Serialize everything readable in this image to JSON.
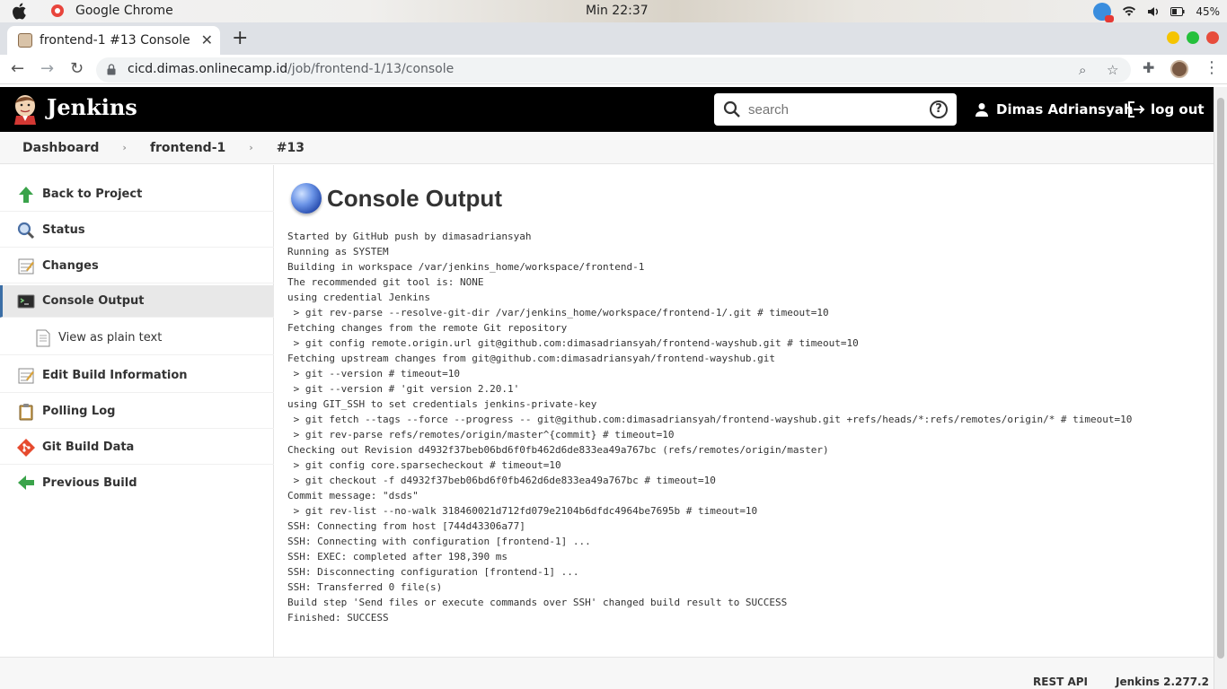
{
  "os": {
    "app_name": "Google Chrome",
    "clock": "Min 22:37",
    "battery": "45%"
  },
  "browser": {
    "tab_title": "frontend-1 #13 Console [",
    "url_domain": "cicd.dimas.onlinecamp.id",
    "url_path": "/job/frontend-1/13/console"
  },
  "header": {
    "brand": "Jenkins",
    "search_placeholder": "search",
    "user_name": "Dimas Adriansyah",
    "logout_label": "log out"
  },
  "breadcrumb": [
    "Dashboard",
    "frontend-1",
    "#13"
  ],
  "sidebar": {
    "items": [
      {
        "label": "Back to Project",
        "icon": "up-arrow-icon"
      },
      {
        "label": "Status",
        "icon": "magnifier-icon"
      },
      {
        "label": "Changes",
        "icon": "notepad-icon"
      },
      {
        "label": "Console Output",
        "icon": "terminal-icon"
      },
      {
        "label": "View as plain text",
        "icon": "document-icon"
      },
      {
        "label": "Edit Build Information",
        "icon": "notepad-edit-icon"
      },
      {
        "label": "Polling Log",
        "icon": "clipboard-icon"
      },
      {
        "label": "Git Build Data",
        "icon": "git-icon"
      },
      {
        "label": "Previous Build",
        "icon": "left-arrow-icon"
      }
    ]
  },
  "main": {
    "title": "Console Output",
    "lines": [
      "Started by GitHub push by dimasadriansyah",
      "Running as SYSTEM",
      "Building in workspace /var/jenkins_home/workspace/frontend-1",
      "The recommended git tool is: NONE",
      "using credential Jenkins",
      " > git rev-parse --resolve-git-dir /var/jenkins_home/workspace/frontend-1/.git # timeout=10",
      "Fetching changes from the remote Git repository",
      " > git config remote.origin.url git@github.com:dimasadriansyah/frontend-wayshub.git # timeout=10",
      "Fetching upstream changes from git@github.com:dimasadriansyah/frontend-wayshub.git",
      " > git --version # timeout=10",
      " > git --version # 'git version 2.20.1'",
      "using GIT_SSH to set credentials jenkins-private-key",
      " > git fetch --tags --force --progress -- git@github.com:dimasadriansyah/frontend-wayshub.git +refs/heads/*:refs/remotes/origin/* # timeout=10",
      " > git rev-parse refs/remotes/origin/master^{commit} # timeout=10",
      "Checking out Revision d4932f37beb06bd6f0fb462d6de833ea49a767bc (refs/remotes/origin/master)",
      " > git config core.sparsecheckout # timeout=10",
      " > git checkout -f d4932f37beb06bd6f0fb462d6de833ea49a767bc # timeout=10",
      "Commit message: \"dsds\"",
      " > git rev-list --no-walk 318460021d712fd079e2104b6dfdc4964be7695b # timeout=10",
      "SSH: Connecting from host [744d43306a77]",
      "SSH: Connecting with configuration [frontend-1] ...",
      "SSH: EXEC: completed after 198,390 ms",
      "SSH: Disconnecting configuration [frontend-1] ...",
      "SSH: Transferred 0 file(s)",
      "Build step 'Send files or execute commands over SSH' changed build result to SUCCESS",
      "Finished: SUCCESS"
    ]
  },
  "footer": {
    "rest_api": "REST API",
    "version": "Jenkins 2.277.2"
  }
}
